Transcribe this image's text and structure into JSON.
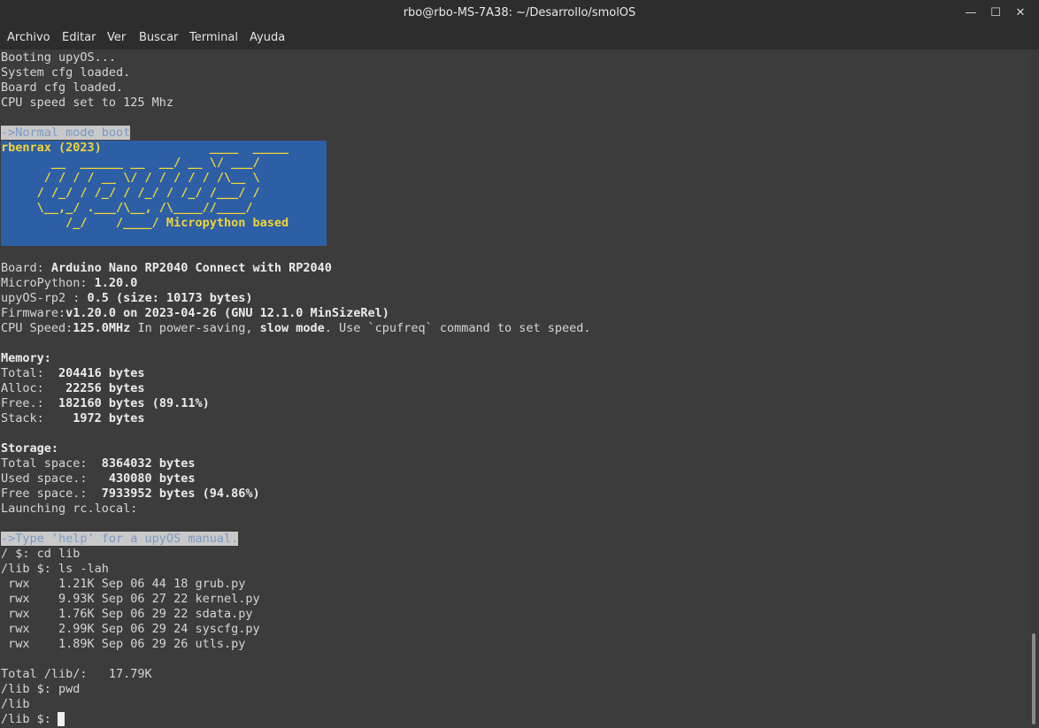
{
  "window": {
    "title": "rbo@rbo-MS-7A38: ~/Desarrollo/smolOS",
    "controls": {
      "minimize": "—",
      "maximize": "☐",
      "close": "✕"
    }
  },
  "menu": [
    "Archivo",
    "Editar",
    "Ver",
    "Buscar",
    "Terminal",
    "Ayuda"
  ],
  "boot": [
    "Booting upyOS...",
    "System cfg loaded.",
    "Board cfg loaded.",
    "CPU speed set to 125 Mhz"
  ],
  "normal_mode": "->Normal mode boot",
  "banner": [
    "rbenrax (2023)               ____  _____",
    "       __  ______ __  __/ __ \\/ ___/",
    "      / / / / __ \\/ / / / / / /\\__ \\",
    "     / /_/ / /_/ / /_/ / /_/ /___/ /",
    "     \\__,_/ .___/\\__, /\\____//____/",
    "         /_/    /____/ Micropython based"
  ],
  "info": {
    "board_label": "Board: ",
    "board_value": "Arduino Nano RP2040 Connect with RP2040",
    "micropython_label": "MicroPython: ",
    "micropython_value": "1.20.0",
    "upyos_label": "upyOS-rp2 : ",
    "upyos_value": "0.5 (size: 10173 bytes)",
    "firmware_label": "Firmware:",
    "firmware_value": "v1.20.0 on 2023-04-26 (GNU 12.1.0 MinSizeRel)",
    "cpu_label": "CPU Speed:",
    "cpu_value": "125.0MHz",
    "cpu_text1": " In power-saving, ",
    "cpu_slow": "slow mode",
    "cpu_text2": ". Use `cpufreq` command to set speed."
  },
  "memory": {
    "heading": "Memory:",
    "rows": [
      {
        "label": "Total:  ",
        "value": "204416 bytes"
      },
      {
        "label": "Alloc:   ",
        "value": "22256 bytes"
      },
      {
        "label": "Free.:  ",
        "value": "182160 bytes (89.11%)"
      },
      {
        "label": "Stack:    ",
        "value": "1972 bytes"
      }
    ]
  },
  "storage": {
    "heading": "Storage:",
    "rows": [
      {
        "label": "Total space:  ",
        "value": "8364032 bytes"
      },
      {
        "label": "Used space.:   ",
        "value": "430080 bytes"
      },
      {
        "label": "Free space.:  ",
        "value": "7933952 bytes (94.86%)"
      }
    ],
    "launching": "Launching rc.local:"
  },
  "help_hint": "->Type 'help' for a upyOS manual.",
  "session": {
    "cmd_cd": "/ $: cd lib",
    "cmd_ls": "/lib $: ls -lah",
    "files": [
      " rwx    1.21K Sep 06 44 18 grub.py",
      " rwx    9.93K Sep 06 27 22 kernel.py",
      " rwx    1.76K Sep 06 29 22 sdata.py",
      " rwx    2.99K Sep 06 29 24 syscfg.py",
      " rwx    1.89K Sep 06 29 26 utls.py"
    ],
    "total": "Total /lib/:   17.79K",
    "cmd_pwd": "/lib $: pwd",
    "pwd_out": "/lib",
    "prompt": "/lib $: "
  }
}
